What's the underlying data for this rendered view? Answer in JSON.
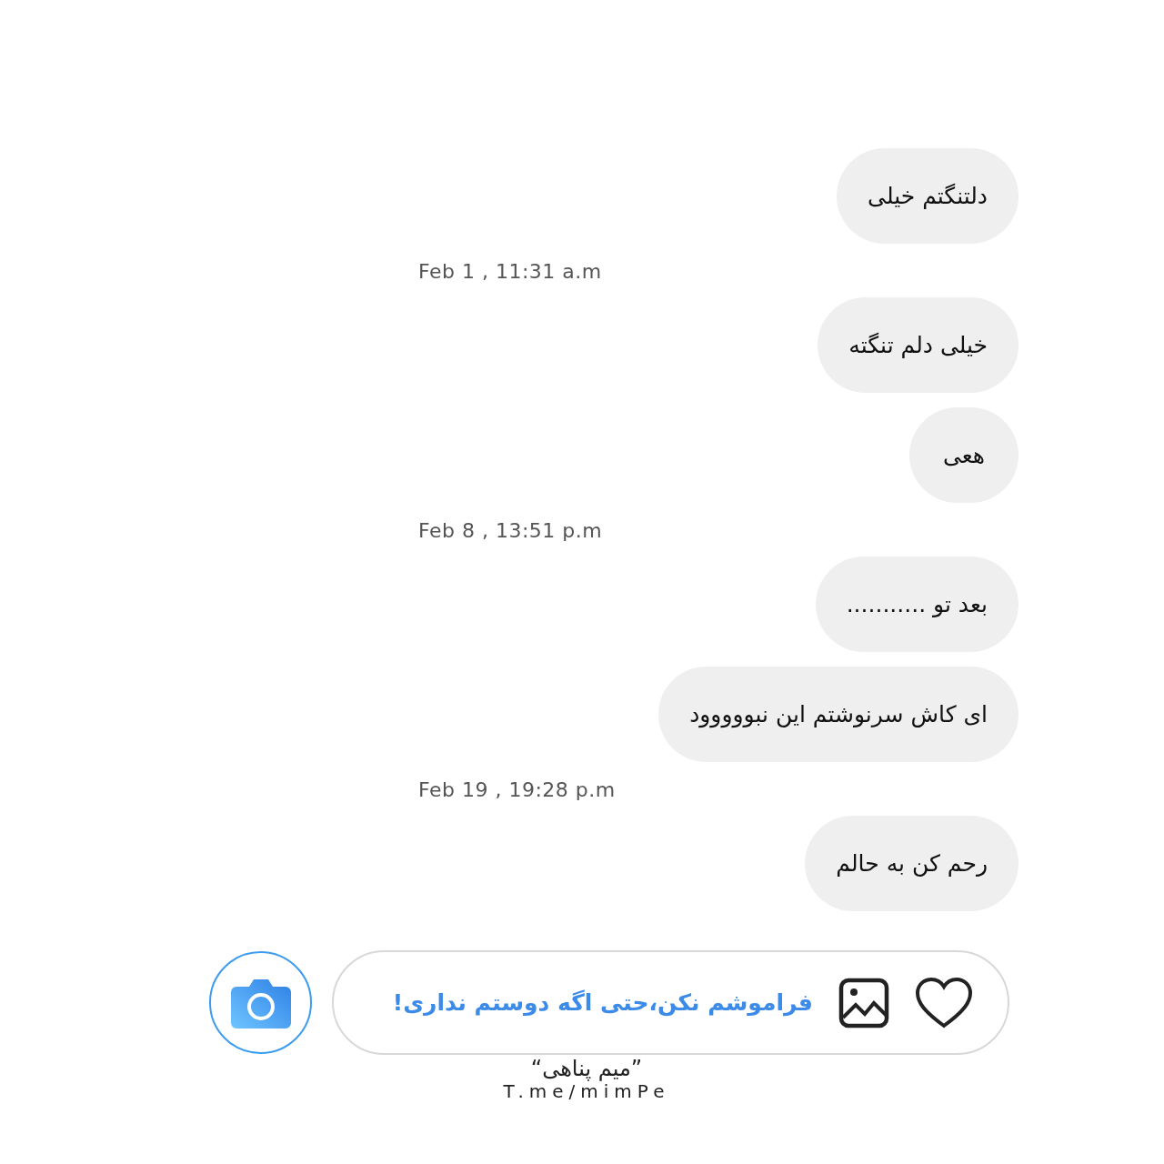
{
  "messages": [
    {
      "kind": "message",
      "text": "دلتنگتم خیلی"
    },
    {
      "kind": "timestamp",
      "text": "Feb 1 , 11:31 a.m"
    },
    {
      "kind": "message",
      "text": "خیلی دلم تنگته"
    },
    {
      "kind": "message",
      "text": "هعی"
    },
    {
      "kind": "timestamp",
      "text": "Feb 8 , 13:51 p.m"
    },
    {
      "kind": "message",
      "text": "بعد تو ..........."
    },
    {
      "kind": "message",
      "text": "ای کاش سرنوشتم این نبووووود"
    },
    {
      "kind": "timestamp",
      "text": "Feb 19 , 19:28 p.m"
    },
    {
      "kind": "message",
      "text": "رحم کن به حالم"
    }
  ],
  "composer": {
    "value": "فراموشم نکن،حتی اگه دوستم نداری!"
  },
  "signature": {
    "name": "”میم پناهی“",
    "link": "T.me/mimPe"
  }
}
